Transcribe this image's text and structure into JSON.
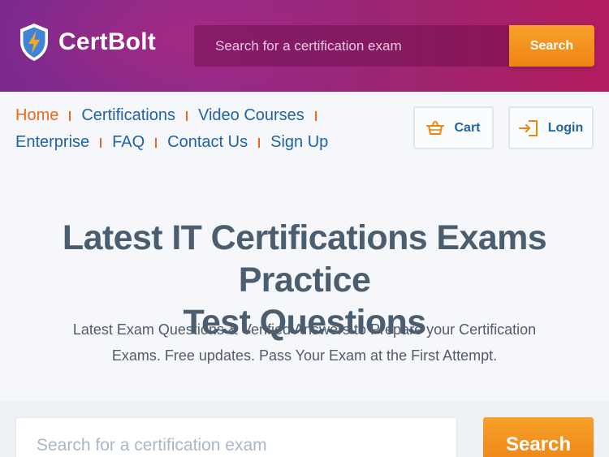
{
  "header": {
    "brand_name": "CertBolt",
    "search": {
      "placeholder": "Search for a certification exam",
      "button_label": "Search"
    }
  },
  "nav": {
    "links": [
      {
        "label": "Home",
        "active": true
      },
      {
        "label": "Certifications"
      },
      {
        "label": "Video Courses"
      },
      {
        "label": "Enterprise"
      },
      {
        "label": "FAQ"
      },
      {
        "label": "Contact Us"
      },
      {
        "label": "Sign Up"
      }
    ],
    "cart_label": "Cart",
    "login_label": "Login"
  },
  "hero": {
    "title_line1": "Latest IT Certifications Exams Practice",
    "title_line2": "Test Questions",
    "subtitle_line1": "Latest Exam Questions & Verified Answers to Prepare your Certification",
    "subtitle_line2": "Exams. Free updates. Pass Your Exam at the First Attempt."
  },
  "main_search": {
    "placeholder": "Search for a certification exam",
    "button_label": "Search"
  },
  "colors": {
    "accent_orange": "#ee8414",
    "link_blue": "#1f63a8",
    "header_purple": "#8f2a8a"
  },
  "icons": {
    "logo": "shield-bolt-icon",
    "cart": "basket-icon",
    "login": "login-arrow-icon"
  }
}
